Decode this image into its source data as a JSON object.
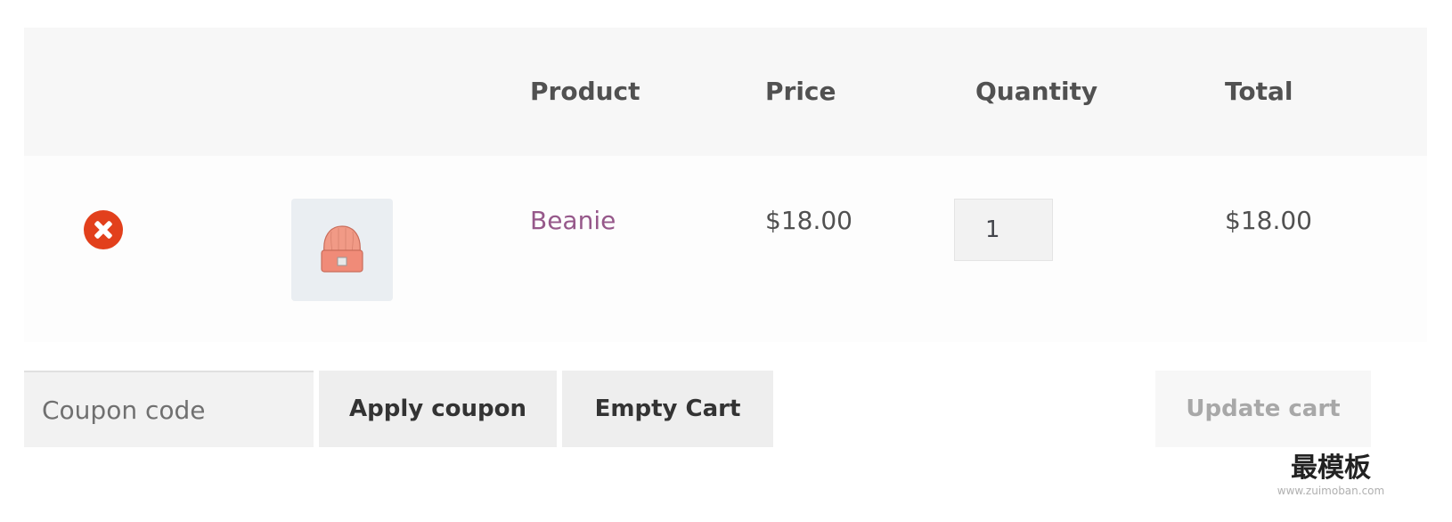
{
  "cart": {
    "columns": {
      "product": "Product",
      "price": "Price",
      "quantity": "Quantity",
      "total": "Total"
    },
    "items": [
      {
        "name": "Beanie",
        "price": "$18.00",
        "quantity": "1",
        "total": "$18.00",
        "thumbnail_icon": "beanie-hat-icon",
        "remove_icon": "remove-x-icon"
      }
    ]
  },
  "actions": {
    "coupon_placeholder": "Coupon code",
    "apply_coupon_label": "Apply coupon",
    "empty_cart_label": "Empty Cart",
    "update_cart_label": "Update cart"
  },
  "watermark": {
    "title": "最模板",
    "url": "www.zuimoban.com"
  },
  "colors": {
    "header_bg": "#f7f7f7",
    "row_bg": "#fdfdfd",
    "link": "#96588a",
    "remove": "#e2401c",
    "button_bg": "#eeeeee"
  }
}
